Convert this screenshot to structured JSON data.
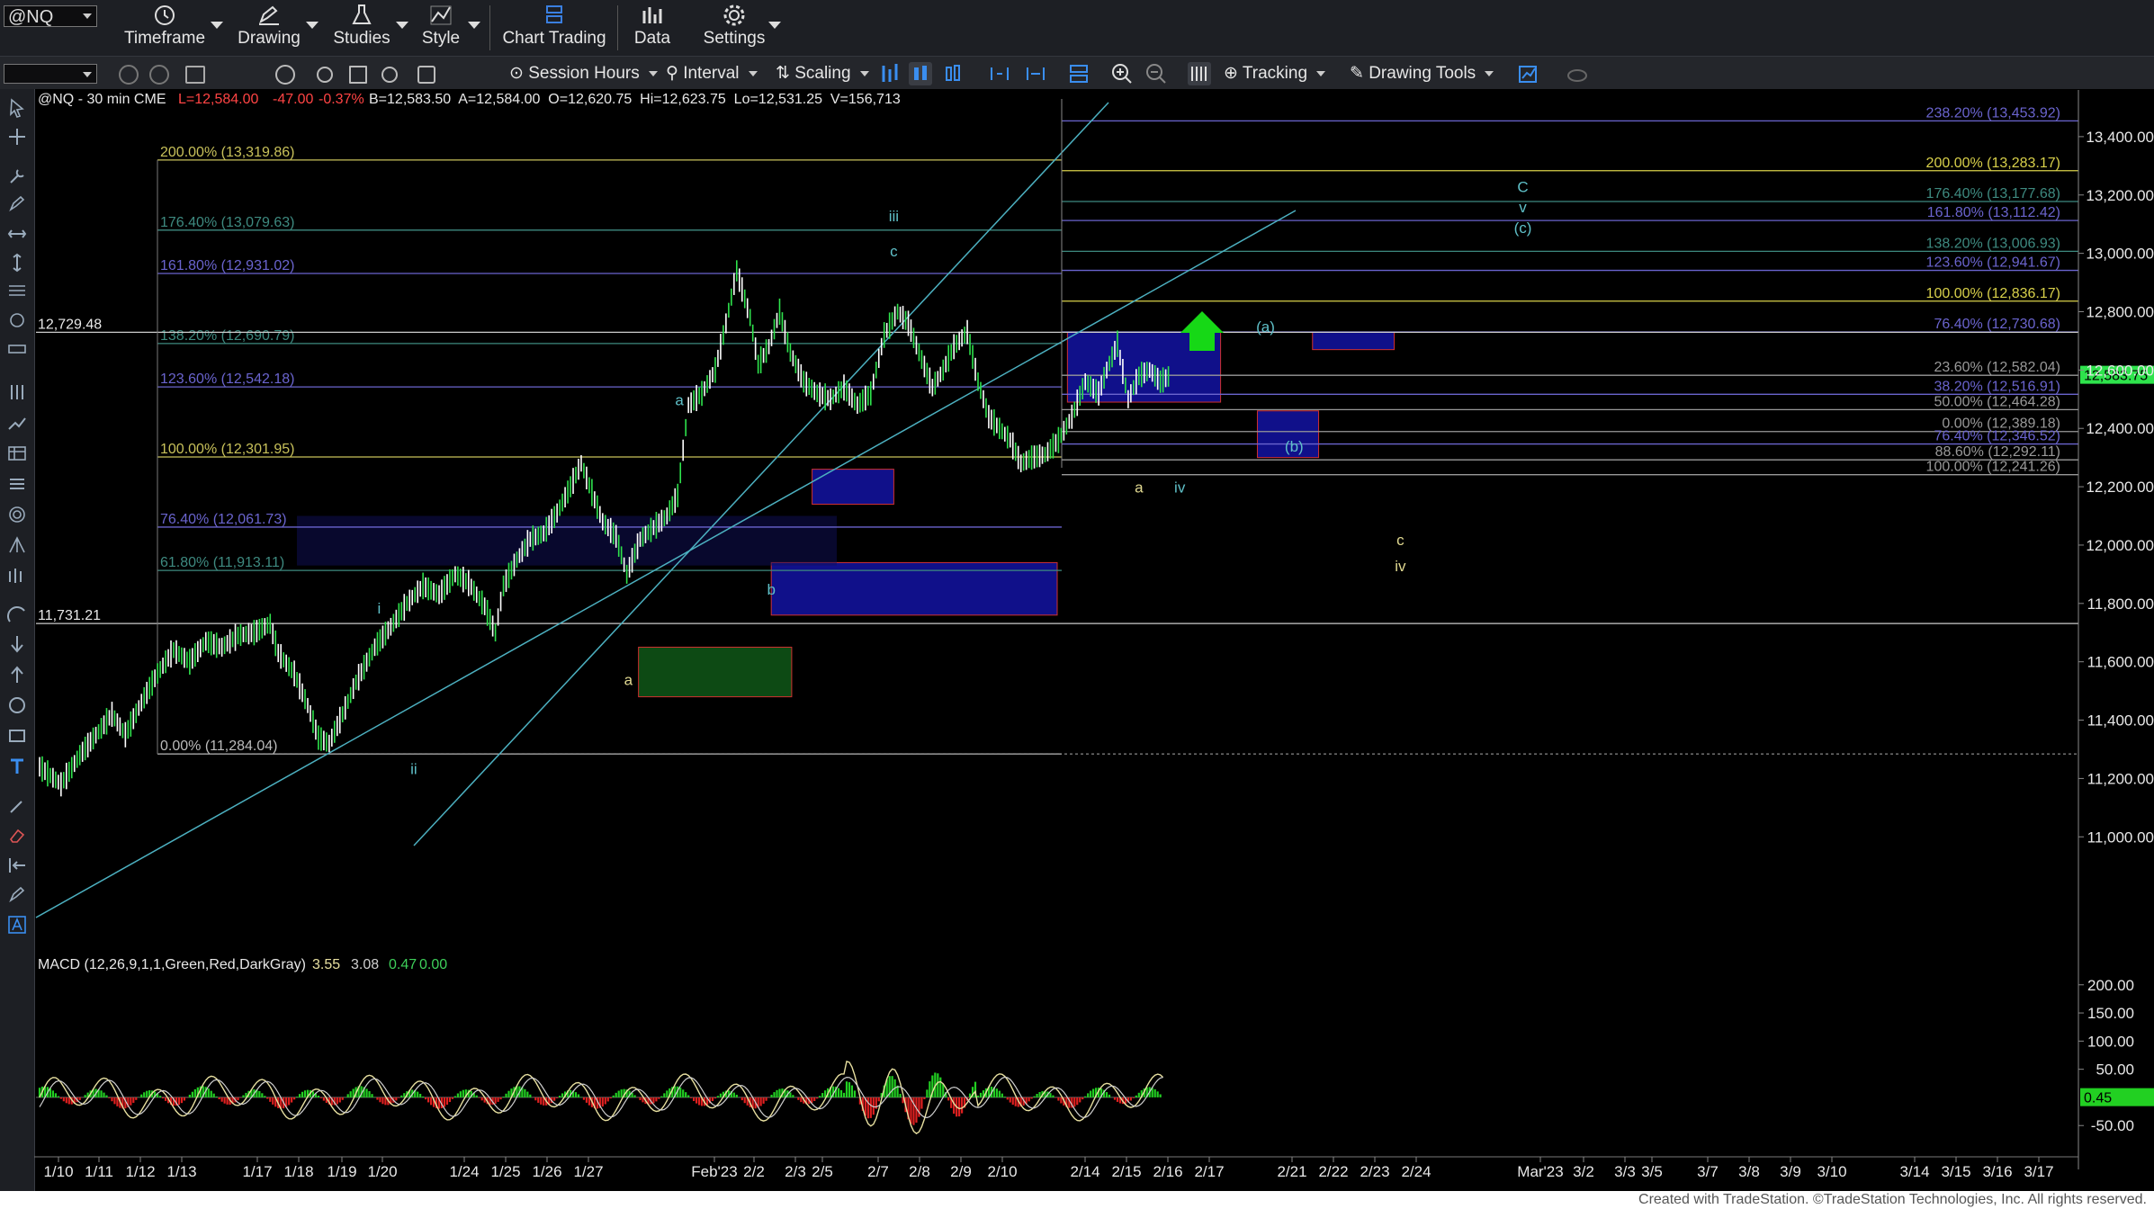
{
  "toolbar": {
    "symbol": "@NQ",
    "items": [
      {
        "label": "Timeframe",
        "icon": "clock-icon"
      },
      {
        "label": "Drawing",
        "icon": "pen-icon"
      },
      {
        "label": "Studies",
        "icon": "flask-icon"
      },
      {
        "label": "Style",
        "icon": "style-icon"
      },
      {
        "label": "Chart Trading",
        "icon": "chart-trading-icon"
      },
      {
        "label": "Data",
        "icon": "data-icon"
      },
      {
        "label": "Settings",
        "icon": "gear-icon"
      }
    ],
    "row2": {
      "session": "Session Hours",
      "interval": "Interval",
      "scaling": "Scaling",
      "tracking": "Tracking",
      "drawing_tools": "Drawing Tools"
    }
  },
  "chart_data": {
    "type": "candlestick",
    "header": "@NQ - 30 min  CME",
    "quote": {
      "last": "L=12,584.00",
      "change": "-47.00",
      "pct": "-0.37%",
      "rest": "B=12,583.50  A=12,584.00  O=12,620.75  Hi=12,623.75  Lo=12,531.25  V=156,713"
    },
    "last_price": "12,583.75",
    "ylim": [
      10600,
      13560
    ],
    "y_ticks": [
      "13,400.00",
      "13,200.00",
      "13,000.00",
      "12,800.00",
      "12,600.00",
      "12,400.00",
      "12,200.00",
      "12,000.00",
      "11,800.00",
      "11,600.00",
      "11,400.00",
      "11,200.00",
      "11,000.00"
    ],
    "x_ticks": [
      "1/10",
      "1/11",
      "1/12",
      "1/13",
      "1/17",
      "1/18",
      "1/19",
      "1/20",
      "1/24",
      "1/25",
      "1/26",
      "1/27",
      "Feb'23",
      "2/2",
      "2/3",
      "2/5",
      "2/7",
      "2/8",
      "2/9",
      "2/10",
      "2/14",
      "2/15",
      "2/16",
      "2/17",
      "2/21",
      "2/22",
      "2/23",
      "2/24",
      "Mar'23",
      "3/2",
      "3/3",
      "3/5",
      "3/7",
      "3/8",
      "3/9",
      "3/10",
      "3/14",
      "3/15",
      "3/16",
      "3/17"
    ],
    "price_path": [
      [
        0,
        11240
      ],
      [
        8,
        11180
      ],
      [
        15,
        11280
      ],
      [
        22,
        11360
      ],
      [
        27,
        11420
      ],
      [
        32,
        11350
      ],
      [
        38,
        11460
      ],
      [
        44,
        11560
      ],
      [
        50,
        11640
      ],
      [
        56,
        11600
      ],
      [
        62,
        11670
      ],
      [
        68,
        11650
      ],
      [
        74,
        11690
      ],
      [
        80,
        11700
      ],
      [
        86,
        11730
      ],
      [
        89,
        11630
      ],
      [
        95,
        11560
      ],
      [
        100,
        11450
      ],
      [
        104,
        11340
      ],
      [
        108,
        11320
      ],
      [
        113,
        11420
      ],
      [
        118,
        11530
      ],
      [
        125,
        11650
      ],
      [
        131,
        11720
      ],
      [
        137,
        11800
      ],
      [
        143,
        11860
      ],
      [
        149,
        11830
      ],
      [
        155,
        11900
      ],
      [
        160,
        11870
      ],
      [
        166,
        11790
      ],
      [
        170,
        11700
      ],
      [
        173,
        11860
      ],
      [
        178,
        11950
      ],
      [
        183,
        12020
      ],
      [
        188,
        12040
      ],
      [
        193,
        12110
      ],
      [
        198,
        12200
      ],
      [
        202,
        12280
      ],
      [
        206,
        12180
      ],
      [
        210,
        12080
      ],
      [
        215,
        12030
      ],
      [
        219,
        11900
      ],
      [
        224,
        12020
      ],
      [
        229,
        12060
      ],
      [
        234,
        12100
      ],
      [
        238,
        12170
      ],
      [
        242,
        12480
      ],
      [
        247,
        12520
      ],
      [
        252,
        12600
      ],
      [
        256,
        12760
      ],
      [
        260,
        12940
      ],
      [
        265,
        12780
      ],
      [
        268,
        12620
      ],
      [
        272,
        12680
      ],
      [
        276,
        12800
      ],
      [
        280,
        12660
      ],
      [
        285,
        12560
      ],
      [
        290,
        12520
      ],
      [
        295,
        12500
      ],
      [
        300,
        12540
      ],
      [
        305,
        12480
      ],
      [
        310,
        12520
      ],
      [
        315,
        12720
      ],
      [
        320,
        12800
      ],
      [
        324,
        12760
      ],
      [
        328,
        12660
      ],
      [
        333,
        12540
      ],
      [
        337,
        12600
      ],
      [
        341,
        12680
      ],
      [
        346,
        12730
      ],
      [
        350,
        12560
      ],
      [
        354,
        12440
      ],
      [
        358,
        12400
      ],
      [
        362,
        12360
      ],
      [
        366,
        12280
      ],
      [
        370,
        12300
      ],
      [
        375,
        12310
      ],
      [
        380,
        12360
      ],
      [
        385,
        12440
      ],
      [
        390,
        12560
      ],
      [
        395,
        12520
      ],
      [
        398,
        12600
      ],
      [
        402,
        12690
      ],
      [
        406,
        12500
      ],
      [
        410,
        12580
      ],
      [
        414,
        12600
      ],
      [
        418,
        12560
      ],
      [
        422,
        12584
      ]
    ],
    "fib_levels": [
      {
        "label": "200.00% (13,319.86)",
        "price": 13319.86,
        "color": "#c8c15a",
        "side": "left"
      },
      {
        "label": "176.40% (13,079.63)",
        "price": 13079.63,
        "color": "#3e8a80",
        "side": "left"
      },
      {
        "label": "161.80% (12,931.02)",
        "price": 12931.02,
        "color": "#6a64ce",
        "side": "left"
      },
      {
        "label": "138.20% (12,690.79)",
        "price": 12690.79,
        "color": "#3e8a80",
        "side": "left"
      },
      {
        "label": "123.60% (12,542.18)",
        "price": 12542.18,
        "color": "#6a64ce",
        "side": "left"
      },
      {
        "label": "100.00% (12,301.95)",
        "price": 12301.95,
        "color": "#c8c15a",
        "side": "left"
      },
      {
        "label": "76.40% (12,061.73)",
        "price": 12061.73,
        "color": "#6a64ce",
        "side": "left"
      },
      {
        "label": "61.80% (11,913.11)",
        "price": 11913.11,
        "color": "#3e8a80",
        "side": "left"
      },
      {
        "label": "0.00% (11,284.04)",
        "price": 11284.04,
        "color": "#bbbbbb",
        "side": "left"
      },
      {
        "label": "238.20% (13,453.92)",
        "price": 13453.92,
        "color": "#6a64ce",
        "side": "right"
      },
      {
        "label": "200.00% (13,283.17)",
        "price": 13283.17,
        "color": "#d8d04a",
        "side": "right"
      },
      {
        "label": "176.40% (13,177.68)",
        "price": 13177.68,
        "color": "#3e8a80",
        "side": "right"
      },
      {
        "label": "161.80% (13,112.42)",
        "price": 13112.42,
        "color": "#6a64ce",
        "side": "right"
      },
      {
        "label": "138.20% (13,006.93)",
        "price": 13006.93,
        "color": "#3e8a80",
        "side": "right"
      },
      {
        "label": "123.60% (12,941.67)",
        "price": 12941.67,
        "color": "#6a64ce",
        "side": "right"
      },
      {
        "label": "100.00% (12,836.17)",
        "price": 12836.17,
        "color": "#d8d04a",
        "side": "right"
      },
      {
        "label": "76.40% (12,730.68)",
        "price": 12730.68,
        "color": "#6a64ce",
        "side": "right"
      },
      {
        "label": "23.60% (12,582.04)",
        "price": 12582.04,
        "color": "#999999",
        "side": "right"
      },
      {
        "label": "38.20% (12,516.91)",
        "price": 12516.91,
        "color": "#6a64ce",
        "side": "right"
      },
      {
        "label": "50.00% (12,464.28)",
        "price": 12464.28,
        "color": "#999999",
        "side": "right"
      },
      {
        "label": "0.00% (12,389.18)",
        "price": 12389.18,
        "color": "#999999",
        "side": "right"
      },
      {
        "label": "76.40% (12,346.52)",
        "price": 12346.52,
        "color": "#6a64ce",
        "side": "right"
      },
      {
        "label": "88.60% (12,292.11)",
        "price": 12292.11,
        "color": "#999999",
        "side": "right"
      },
      {
        "label": "100.00% (12,241.26)",
        "price": 12241.26,
        "color": "#999999",
        "side": "right"
      }
    ],
    "hlines": [
      {
        "label": "12,729.48",
        "price": 12729.48
      },
      {
        "label": "11,731.21",
        "price": 11731.21
      }
    ],
    "zones": [
      {
        "p1": 12730,
        "p2": 12490,
        "x1": 0.505,
        "x2": 0.58,
        "color": "blue"
      },
      {
        "p1": 12260,
        "p2": 12140,
        "x1": 0.38,
        "x2": 0.42,
        "color": "blue"
      },
      {
        "p1": 11940,
        "p2": 11760,
        "x1": 0.36,
        "x2": 0.5,
        "color": "blue"
      },
      {
        "p1": 11650,
        "p2": 11480,
        "x1": 0.295,
        "x2": 0.37,
        "color": "green"
      },
      {
        "p1": 12730,
        "p2": 12670,
        "x1": 0.625,
        "x2": 0.665,
        "color": "blue"
      },
      {
        "p1": 12460,
        "p2": 12300,
        "x1": 0.598,
        "x2": 0.628,
        "color": "blue"
      }
    ],
    "wave_labels": [
      {
        "text": "i",
        "price": 11765,
        "x": 0.168,
        "color": "#5fc0c8"
      },
      {
        "text": "ii",
        "price": 11215,
        "x": 0.185,
        "color": "#5fc0c8"
      },
      {
        "text": "a",
        "price": 12480,
        "x": 0.315,
        "color": "#5fc0c8"
      },
      {
        "text": "b",
        "price": 11830,
        "x": 0.36,
        "color": "#5fc0c8"
      },
      {
        "text": "a",
        "price": 11520,
        "x": 0.29,
        "color": "#e0d890"
      },
      {
        "text": "iii",
        "price": 13110,
        "x": 0.42,
        "color": "#5fc0c8"
      },
      {
        "text": "c",
        "price": 12990,
        "x": 0.42,
        "color": "#5fc0c8"
      },
      {
        "text": "a",
        "price": 12180,
        "x": 0.54,
        "color": "#e0d890"
      },
      {
        "text": "iv",
        "price": 12180,
        "x": 0.56,
        "color": "#5fc0c8"
      },
      {
        "text": "(a)",
        "price": 12730,
        "x": 0.602,
        "color": "#5fc0c8"
      },
      {
        "text": "(b)",
        "price": 12320,
        "x": 0.616,
        "color": "#5fc0c8"
      },
      {
        "text": "C",
        "price": 13210,
        "x": 0.728,
        "color": "#5fc0c8"
      },
      {
        "text": "v",
        "price": 13140,
        "x": 0.728,
        "color": "#5fc0c8"
      },
      {
        "text": "(c)",
        "price": 13070,
        "x": 0.728,
        "color": "#5fc0c8"
      },
      {
        "text": "c",
        "price": 12000,
        "x": 0.668,
        "color": "#e0d890"
      },
      {
        "text": "iv",
        "price": 11910,
        "x": 0.668,
        "color": "#e0d890"
      }
    ],
    "macd": {
      "label": "MACD (12,26,9,1,1,Green,Red,DarkGray)",
      "values": [
        "3.55",
        "3.08",
        "0.47",
        "0.00"
      ],
      "value_colors": [
        "#e8e0a0",
        "#cfcfcf",
        "#3ecf5a",
        "#3ecf5a"
      ],
      "ylim": [
        -80,
        230
      ],
      "ticks": [
        "200.00",
        "150.00",
        "100.00",
        "50.00",
        "-50.00"
      ],
      "current": "0.45"
    }
  },
  "footer": "Created with TradeStation. ©TradeStation Technologies, Inc. All rights reserved."
}
